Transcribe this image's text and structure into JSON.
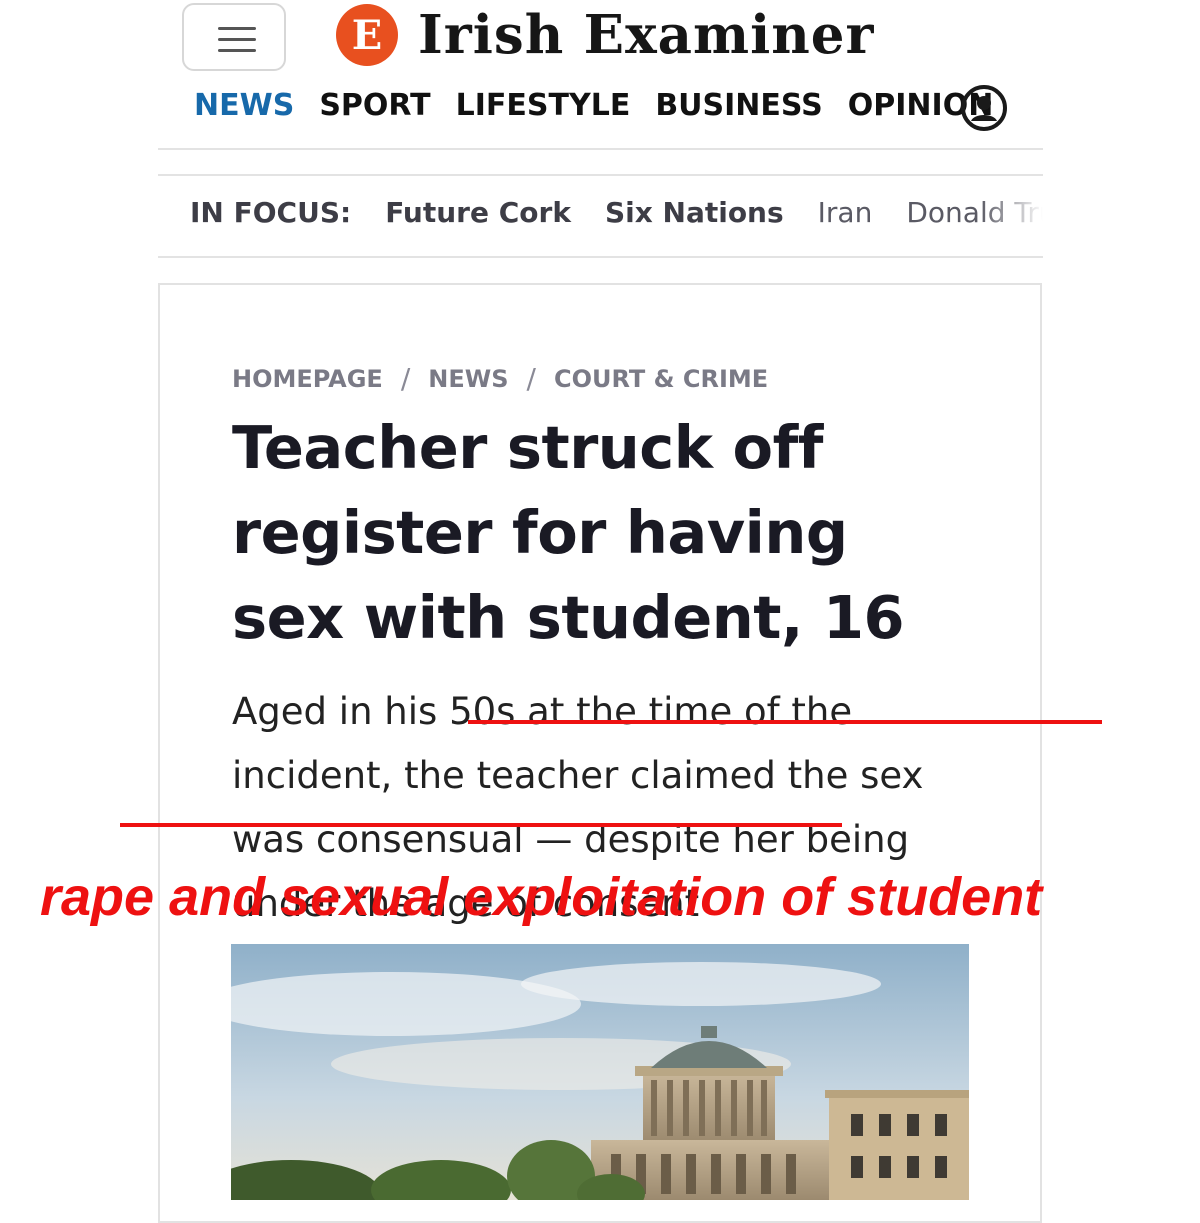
{
  "header": {
    "logo_mark": "E",
    "logo_text": "Irish Examiner",
    "nav": [
      "NEWS",
      "SPORT",
      "LIFESTYLE",
      "BUSINESS",
      "OPINION"
    ],
    "active_nav": "NEWS",
    "accent_color": "#1769aa",
    "brand_color": "#e8501f"
  },
  "in_focus": {
    "label": "IN FOCUS:",
    "items": [
      "Future Cork",
      "Six Nations",
      "Iran",
      "Donald Trump"
    ]
  },
  "article": {
    "breadcrumb": [
      "HOMEPAGE",
      "NEWS",
      "COURT & CRIME"
    ],
    "headline": "Teacher struck off register for having sex with student, 16",
    "standfirst": "Aged in his 50s at the time of the incident, the teacher claimed the sex was consensual — despite her being under the age of consent"
  },
  "annotation": {
    "text": "rape and sexual exploitation of student",
    "color": "#ee1111"
  },
  "icons": {
    "menu": "hamburger-menu-icon",
    "account": "user-account-icon"
  }
}
